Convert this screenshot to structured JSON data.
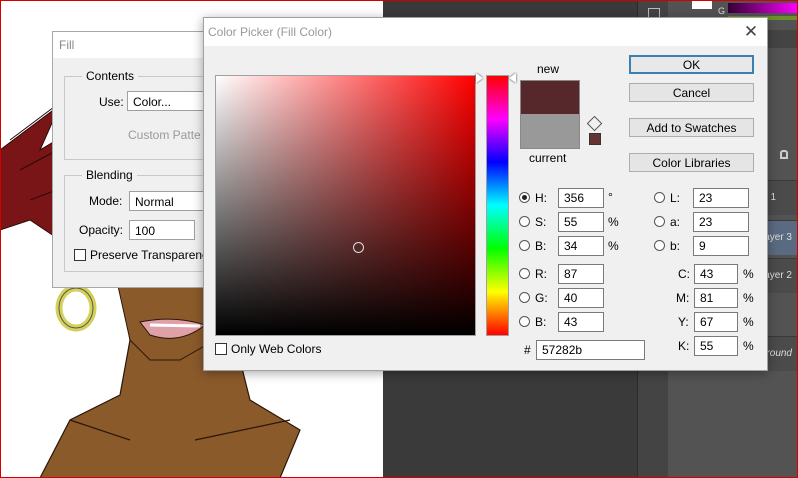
{
  "fill_dialog": {
    "title": "Fill",
    "contents_label": "Contents",
    "use_label": "Use:",
    "use_value": "Color...",
    "custom_pattern_label": "Custom Patte",
    "blending_label": "Blending",
    "mode_label": "Mode:",
    "mode_value": "Normal",
    "opacity_label": "Opacity:",
    "opacity_value": "100",
    "preserve_label": "Preserve Transparenc"
  },
  "color_picker": {
    "title": "Color Picker (Fill Color)",
    "close_glyph": "✕",
    "new_label": "new",
    "current_label": "current",
    "new_color": "#57282b",
    "current_color": "#999999",
    "buttons": {
      "ok": "OK",
      "cancel": "Cancel",
      "add_to_swatches": "Add to Swatches",
      "color_libraries": "Color Libraries"
    },
    "hsb": {
      "h_label": "H:",
      "h_value": "356",
      "h_unit": "°",
      "s_label": "S:",
      "s_value": "55",
      "s_unit": "%",
      "b_label": "B:",
      "b_value": "34",
      "b_unit": "%"
    },
    "rgb": {
      "r_label": "R:",
      "r_value": "87",
      "g_label": "G:",
      "g_value": "40",
      "b_label": "B:",
      "b_value": "43"
    },
    "lab": {
      "l_label": "L:",
      "l_value": "23",
      "a_label": "a:",
      "a_value": "23",
      "b_label": "b:",
      "b_value": "9"
    },
    "cmyk": {
      "c_label": "C:",
      "c_value": "43",
      "c_unit": "%",
      "m_label": "M:",
      "m_value": "81",
      "m_unit": "%",
      "y_label": "Y:",
      "y_value": "67",
      "y_unit": "%",
      "k_label": "K:",
      "k_value": "55",
      "k_unit": "%"
    },
    "hex_label": "#",
    "hex_value": "57282b",
    "only_web_colors_label": "Only Web Colors",
    "hue_fraction": 0.011,
    "saturation_fraction": 0.55,
    "brightness_fraction": 0.34
  },
  "layers_panel": {
    "letter_g": "G",
    "layer_1": "1",
    "layer_3": "ayer 3",
    "layer_2": "ayer 2",
    "background": "ground"
  },
  "colors": {
    "hair": "#7a1517",
    "skin": "#8b5a2b",
    "earring": "#d4d05a",
    "accent_blue": "#3c7fb1"
  }
}
